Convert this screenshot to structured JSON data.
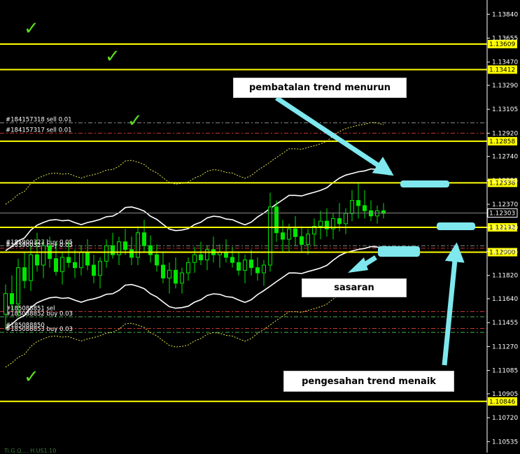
{
  "chart_data": {
    "type": "candlestick",
    "symbol": "",
    "price_axis": {
      "min": 1.1045,
      "max": 1.1395,
      "tick_labels": [
        "1.13840",
        "1.13655",
        "1.13470",
        "1.13290",
        "1.13105",
        "1.12920",
        "1.12740",
        "1.12555",
        "1.12370",
        "1.12190",
        "1.12005",
        "1.11820",
        "1.11640",
        "1.11455",
        "1.11270",
        "1.11085",
        "1.10905",
        "1.10720",
        "1.10535"
      ],
      "ticks": [
        1.1384,
        1.13655,
        1.1347,
        1.1329,
        1.13105,
        1.1292,
        1.1274,
        1.12555,
        1.1237,
        1.1219,
        1.12005,
        1.1182,
        1.1164,
        1.11455,
        1.1127,
        1.11085,
        1.10905,
        1.1072,
        1.10535
      ],
      "current_price": 1.12303,
      "current_price_label": "1.12303"
    },
    "horizontal_levels": [
      {
        "price": 1.13609,
        "label": "1.13609",
        "color": "#ffff00"
      },
      {
        "price": 1.13412,
        "label": "1.13412",
        "color": "#ffff00"
      },
      {
        "price": 1.12858,
        "label": "1.12858",
        "color": "#ffff00"
      },
      {
        "price": 1.12536,
        "label": "1.12536",
        "color": "#ffff00"
      },
      {
        "price": 1.12192,
        "label": "1.12192",
        "color": "#ffff00"
      },
      {
        "price": 1.12,
        "label": "1.12000",
        "color": "#ffff00"
      },
      {
        "price": 1.10846,
        "label": "1.10846",
        "color": "#ffff00"
      }
    ],
    "order_lines": [
      {
        "price": 1.13,
        "label": "#184157318 sell 0.01",
        "color": "#8a8a8a"
      },
      {
        "price": 1.1292,
        "label": "#184157317 sell 0.01",
        "color": "#cc3333"
      },
      {
        "price": 1.1205,
        "label": "#185900323 buy 0.05",
        "color": "#8a8a8a"
      },
      {
        "price": 1.1203,
        "label": "#185900321 buy 0.05",
        "color": "#cc3333"
      },
      {
        "price": 1.1154,
        "label": "#185088851 sel",
        "color": "#cc3333"
      },
      {
        "price": 1.115,
        "label": "#185088852 buy 0.03",
        "color": "#4caf50"
      },
      {
        "price": 1.1141,
        "label": "#185088850",
        "color": "#cc3333"
      },
      {
        "price": 1.1138,
        "label": "#185088853 buy 0.03",
        "color": "#4caf50"
      }
    ],
    "colors": {
      "background": "#000000",
      "bull_candle": "#00e600",
      "bear_candle": "#00e600",
      "level_line": "#ffff00",
      "band": "#ffffff",
      "ma_dotted": "#e6e64d",
      "arrow": "#7ee8ee",
      "checkmark": "#5bdc1e"
    },
    "ohlc": [
      [
        1.1152,
        1.1175,
        1.114,
        1.1168
      ],
      [
        1.1168,
        1.1182,
        1.1155,
        1.116
      ],
      [
        1.116,
        1.1195,
        1.115,
        1.1188
      ],
      [
        1.1188,
        1.12,
        1.1172,
        1.1178
      ],
      [
        1.1178,
        1.1205,
        1.117,
        1.1198
      ],
      [
        1.1198,
        1.1215,
        1.1185,
        1.119
      ],
      [
        1.119,
        1.121,
        1.118,
        1.1205
      ],
      [
        1.1205,
        1.1212,
        1.1188,
        1.1195
      ],
      [
        1.1195,
        1.1208,
        1.1182,
        1.1185
      ],
      [
        1.1185,
        1.12,
        1.1175,
        1.1196
      ],
      [
        1.1196,
        1.1208,
        1.1188,
        1.1192
      ],
      [
        1.1192,
        1.1202,
        1.118,
        1.1188
      ],
      [
        1.1188,
        1.1205,
        1.1182,
        1.12
      ],
      [
        1.12,
        1.121,
        1.1186,
        1.119
      ],
      [
        1.119,
        1.1198,
        1.1176,
        1.1182
      ],
      [
        1.1182,
        1.1196,
        1.1172,
        1.1193
      ],
      [
        1.1193,
        1.121,
        1.1188,
        1.1205
      ],
      [
        1.1205,
        1.1215,
        1.1195,
        1.1198
      ],
      [
        1.1198,
        1.1212,
        1.119,
        1.1208
      ],
      [
        1.1208,
        1.1218,
        1.1198,
        1.1202
      ],
      [
        1.1202,
        1.1212,
        1.119,
        1.1196
      ],
      [
        1.1196,
        1.122,
        1.119,
        1.1215
      ],
      [
        1.1215,
        1.1225,
        1.12,
        1.1205
      ],
      [
        1.1205,
        1.1213,
        1.1192,
        1.1198
      ],
      [
        1.1198,
        1.1206,
        1.1185,
        1.119
      ],
      [
        1.119,
        1.12,
        1.1176,
        1.118
      ],
      [
        1.118,
        1.1192,
        1.1168,
        1.1186
      ],
      [
        1.1186,
        1.1196,
        1.1172,
        1.1176
      ],
      [
        1.1176,
        1.1188,
        1.1168,
        1.1184
      ],
      [
        1.1184,
        1.1196,
        1.1178,
        1.1192
      ],
      [
        1.1192,
        1.1204,
        1.1184,
        1.1198
      ],
      [
        1.1198,
        1.1208,
        1.119,
        1.1194
      ],
      [
        1.1194,
        1.1205,
        1.1186,
        1.1202
      ],
      [
        1.1202,
        1.1212,
        1.1192,
        1.1198
      ],
      [
        1.1198,
        1.1206,
        1.1188,
        1.12
      ],
      [
        1.12,
        1.121,
        1.1192,
        1.1196
      ],
      [
        1.1196,
        1.1204,
        1.1188,
        1.1192
      ],
      [
        1.1192,
        1.12,
        1.1182,
        1.1186
      ],
      [
        1.1186,
        1.1198,
        1.1176,
        1.1194
      ],
      [
        1.1194,
        1.1202,
        1.1182,
        1.1188
      ],
      [
        1.1188,
        1.1196,
        1.1178,
        1.1184
      ],
      [
        1.1184,
        1.1194,
        1.1174,
        1.119
      ],
      [
        1.119,
        1.1246,
        1.1185,
        1.1235
      ],
      [
        1.1235,
        1.124,
        1.1208,
        1.1215
      ],
      [
        1.1215,
        1.1225,
        1.12,
        1.121
      ],
      [
        1.121,
        1.1222,
        1.12,
        1.1218
      ],
      [
        1.1218,
        1.1228,
        1.1205,
        1.1212
      ],
      [
        1.1212,
        1.122,
        1.12,
        1.1206
      ],
      [
        1.1206,
        1.1218,
        1.1198,
        1.1214
      ],
      [
        1.1214,
        1.1226,
        1.1205,
        1.122
      ],
      [
        1.122,
        1.1232,
        1.121,
        1.1224
      ],
      [
        1.1224,
        1.1234,
        1.1212,
        1.1218
      ],
      [
        1.1218,
        1.123,
        1.121,
        1.1226
      ],
      [
        1.1226,
        1.1238,
        1.1216,
        1.1222
      ],
      [
        1.1222,
        1.1234,
        1.1214,
        1.123
      ],
      [
        1.123,
        1.1248,
        1.1224,
        1.124
      ],
      [
        1.124,
        1.1254,
        1.1226,
        1.1236
      ],
      [
        1.1236,
        1.1248,
        1.1226,
        1.1232
      ],
      [
        1.1232,
        1.124,
        1.1224,
        1.1228
      ],
      [
        1.1228,
        1.1236,
        1.1222,
        1.1232
      ],
      [
        1.1232,
        1.1238,
        1.1226,
        1.123
      ]
    ]
  },
  "callouts": {
    "invalidation": "pembatalan trend menurun",
    "target": "sasaran",
    "confirmation": "pengesahan trend menaik"
  },
  "footer": {
    "text": "Ti.G.Q.... H.US1.10"
  }
}
